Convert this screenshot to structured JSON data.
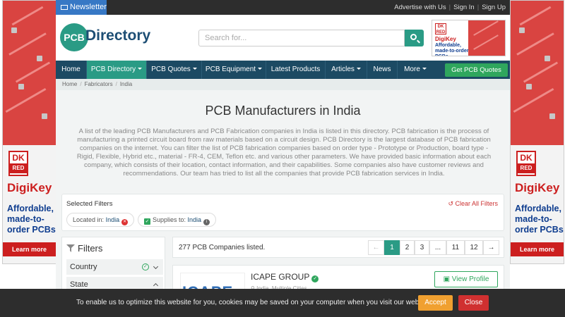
{
  "ads": {
    "brand": "DigiKey",
    "logo_top": "DK",
    "logo_bottom": "RED",
    "tagline": "Affordable, made-to-order PCBs",
    "learn_more": "Learn more",
    "header_tagline": "Affordable, made-to-order PCBs",
    "brand_color": "#cc1f1f"
  },
  "topbar": {
    "newsletter": "Newsletter",
    "links": [
      "Advertise with Us",
      "Sign In",
      "Sign Up"
    ]
  },
  "header": {
    "logo_mark": "PCB",
    "logo_word": "Directory",
    "search_placeholder": "Search for...",
    "accent": "#2a9b85"
  },
  "nav": {
    "items": [
      "Home",
      "PCB Directory",
      "PCB Quotes",
      "PCB Equipment",
      "Latest Products",
      "Articles",
      "News",
      "More"
    ],
    "active": "PCB Directory",
    "quote_button": "Get PCB Quotes"
  },
  "breadcrumb": [
    "Home",
    "Fabricators",
    "India"
  ],
  "page": {
    "title": "PCB Manufacturers in India",
    "intro": "A list of the leading PCB Manufacturers and PCB Fabrication companies in India is listed in this directory. PCB fabrication is the process of manufacturing a printed circuit board from raw materials based on a circuit design. PCB Directory is the largest database of PCB fabrication companies on the internet. You can filter the list of PCB fabrication companies based on order type - Prototype or Production, board type - Rigid, Flexible, Hybrid etc., material - FR-4, CEM, Teflon etc. and various other parameters. We have provided basic information about each company, which consists of their location, contact information, and their capabilities. Some companies also have customer reviews and recommendations. Our team has tried to list all the companies that provide PCB fabrication services in India."
  },
  "selected_filters": {
    "title": "Selected Filters",
    "clear_all": "Clear All Filters",
    "pills": [
      {
        "label": "Located in:",
        "value": "India"
      },
      {
        "label": "Supplies to:",
        "value": "India"
      }
    ]
  },
  "sidebar": {
    "title": "Filters",
    "groups": [
      "Country",
      "State"
    ]
  },
  "results": {
    "count_text": "277 PCB Companies listed.",
    "pages": [
      "←",
      "1",
      "2",
      "3",
      "...",
      "11",
      "12",
      "→"
    ],
    "current_page": "1"
  },
  "company": {
    "name": "ICAPE GROUP",
    "logo_text": "ICAPE",
    "location": "India, Multiple Cities",
    "view_profile": "View Profile"
  },
  "cookie": {
    "text": "To enable us to optimize this website for you, cookies may be saved on your computer when you visit our website.",
    "accept": "Accept",
    "close": "Close"
  }
}
